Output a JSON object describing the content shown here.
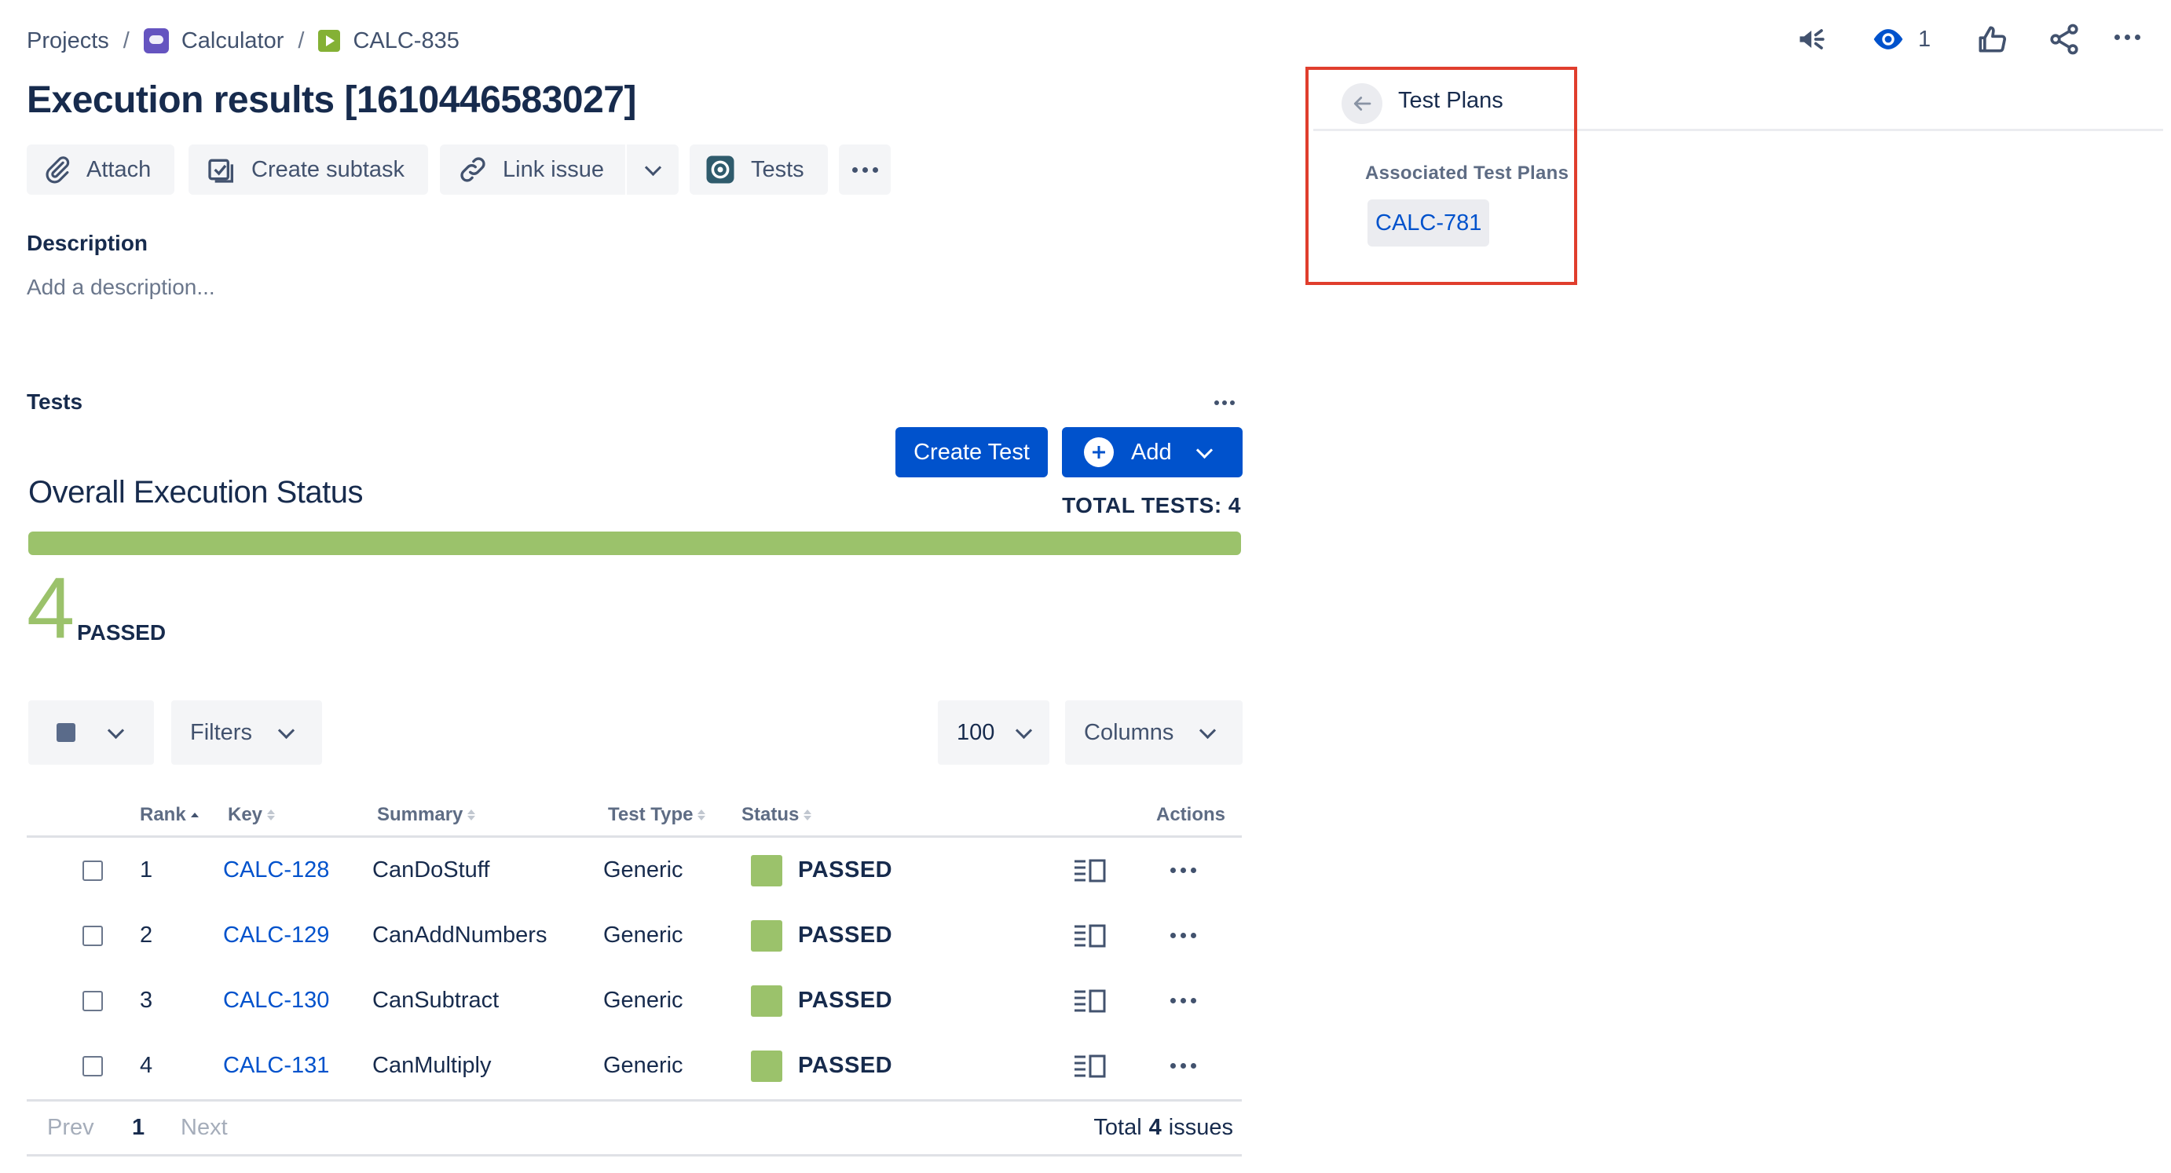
{
  "breadcrumb": {
    "items": [
      "Projects",
      "Calculator",
      "CALC-835"
    ],
    "separator": "/"
  },
  "issue": {
    "title": "Execution results [1610446583027]"
  },
  "toolbar": {
    "attach": "Attach",
    "create_subtask": "Create subtask",
    "link_issue": "Link issue",
    "tests": "Tests"
  },
  "top_actions": {
    "watch_count": "1"
  },
  "description": {
    "label": "Description",
    "placeholder": "Add a description..."
  },
  "tests_section": {
    "label": "Tests",
    "create_test": "Create Test",
    "add": "Add",
    "overall_title": "Overall Execution Status",
    "total_tests": "TOTAL TESTS: 4",
    "passed_count": "4",
    "passed_label": "PASSED",
    "progress_passed_percent": 100,
    "progress_color": "#9BC26B"
  },
  "filters": {
    "filters_label": "Filters",
    "page_size": "100",
    "columns_label": "Columns"
  },
  "table": {
    "headers": {
      "rank": "Rank",
      "key": "Key",
      "summary": "Summary",
      "test_type": "Test Type",
      "status": "Status",
      "actions": "Actions"
    },
    "rows": [
      {
        "rank": "1",
        "key": "CALC-128",
        "summary": "CanDoStuff",
        "type": "Generic",
        "status": "PASSED"
      },
      {
        "rank": "2",
        "key": "CALC-129",
        "summary": "CanAddNumbers",
        "type": "Generic",
        "status": "PASSED"
      },
      {
        "rank": "3",
        "key": "CALC-130",
        "summary": "CanSubtract",
        "type": "Generic",
        "status": "PASSED"
      },
      {
        "rank": "4",
        "key": "CALC-131",
        "summary": "CanMultiply",
        "type": "Generic",
        "status": "PASSED"
      }
    ]
  },
  "pagination": {
    "prev": "Prev",
    "current": "1",
    "next": "Next",
    "total_prefix": "Total",
    "total_count": "4",
    "total_suffix": "issues"
  },
  "right_panel": {
    "title": "Test Plans",
    "associated_label": "Associated Test Plans",
    "plan_key": "CALC-781"
  },
  "colors": {
    "accent": "#0052CC",
    "passed": "#9BC26B",
    "highlight_box": "#E03E2D"
  }
}
